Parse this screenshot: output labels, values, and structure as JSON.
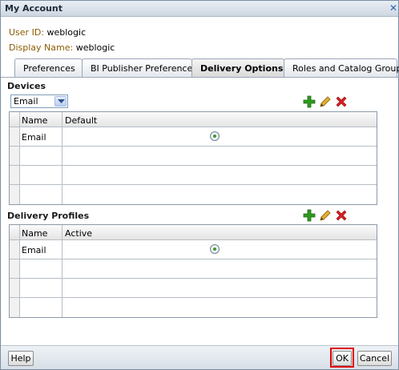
{
  "window": {
    "title": "My Account",
    "close_glyph": "✕"
  },
  "account": {
    "user_id_label": "User ID:",
    "user_id_value": "weblogic",
    "display_name_label": "Display Name:",
    "display_name_value": "weblogic"
  },
  "tabs": [
    {
      "label": "Preferences",
      "active": false
    },
    {
      "label": "BI Publisher Preferences",
      "active": false
    },
    {
      "label": "Delivery Options",
      "active": true
    },
    {
      "label": "Roles and Catalog Groups",
      "active": false
    }
  ],
  "devices": {
    "section_label": "Devices",
    "type_select": {
      "value": "Email"
    },
    "columns": [
      "Name",
      "Default"
    ],
    "rows": [
      {
        "name": "Email",
        "default_selected": true
      },
      {
        "name": "",
        "default_selected": false
      },
      {
        "name": "",
        "default_selected": false
      },
      {
        "name": "",
        "default_selected": false
      }
    ]
  },
  "delivery_profiles": {
    "section_label": "Delivery Profiles",
    "columns": [
      "Name",
      "Active"
    ],
    "rows": [
      {
        "name": "Email",
        "active_selected": true
      },
      {
        "name": "",
        "active_selected": false
      },
      {
        "name": "",
        "active_selected": false
      },
      {
        "name": "",
        "active_selected": false
      }
    ]
  },
  "toolbar_icons": [
    "add-icon",
    "edit-pencil-icon",
    "delete-x-icon"
  ],
  "colors": {
    "add_green": "#2f9a1f",
    "edit_pencil": "#d49a12",
    "delete_red": "#d81f1f",
    "highlight_red": "#e00000"
  },
  "footer": {
    "help_label": "Help",
    "ok_label": "OK",
    "cancel_label": "Cancel"
  }
}
